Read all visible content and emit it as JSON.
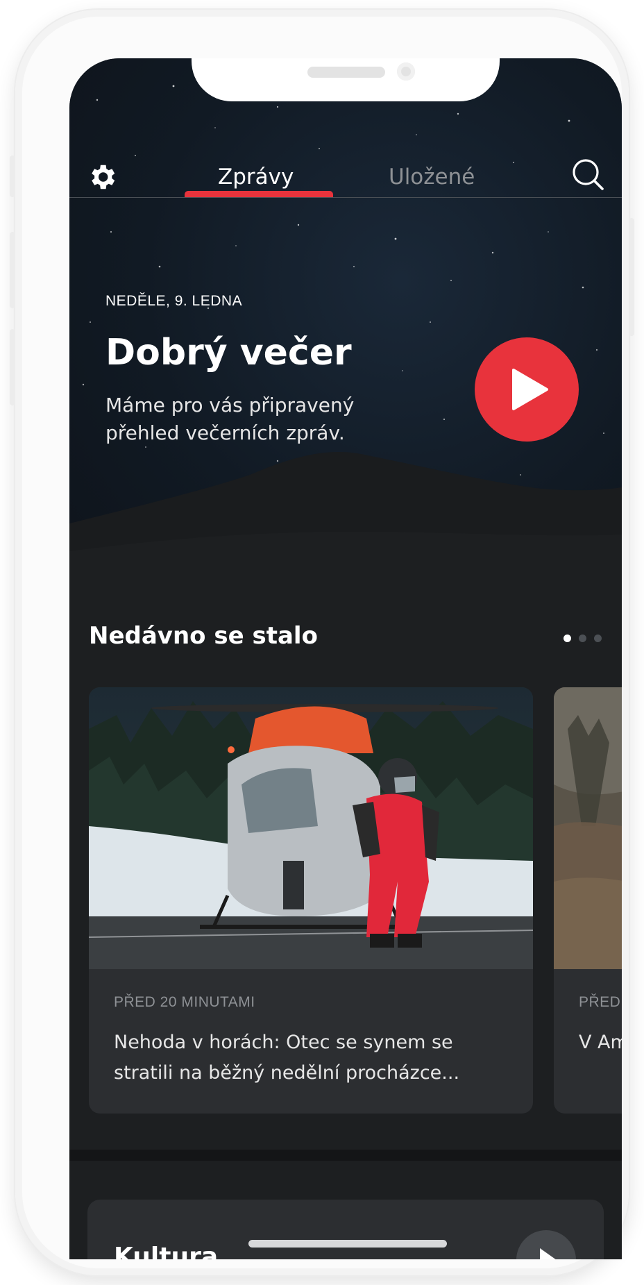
{
  "tabs": [
    {
      "label": "Zprávy",
      "active": true
    },
    {
      "label": "Uložené",
      "active": false
    }
  ],
  "hero": {
    "date": "NEDĚLE, 9. LEDNA",
    "greeting": "Dobrý večer",
    "subtitle": "Máme pro vás připravený přehled večerních zpráv."
  },
  "recent": {
    "title": "Nedávno se stalo",
    "pager": {
      "pages": 3,
      "active_index": 0
    },
    "cards": [
      {
        "time": "PŘED 20 MINUTAMI",
        "headline": "Nehoda v horách: Otec se synem se stratili na běžný nedělní procházce..."
      },
      {
        "time": "PŘED",
        "headline": "V Am Víc p"
      }
    ]
  },
  "bottom_card": {
    "title": "Kultura"
  },
  "icons": {
    "settings": "gear-icon",
    "search": "search-icon",
    "play": "play-icon"
  },
  "colors": {
    "accent": "#e8333c",
    "background": "#1d1f21",
    "card": "#2c2e31",
    "inactive_text": "#8e9195"
  }
}
